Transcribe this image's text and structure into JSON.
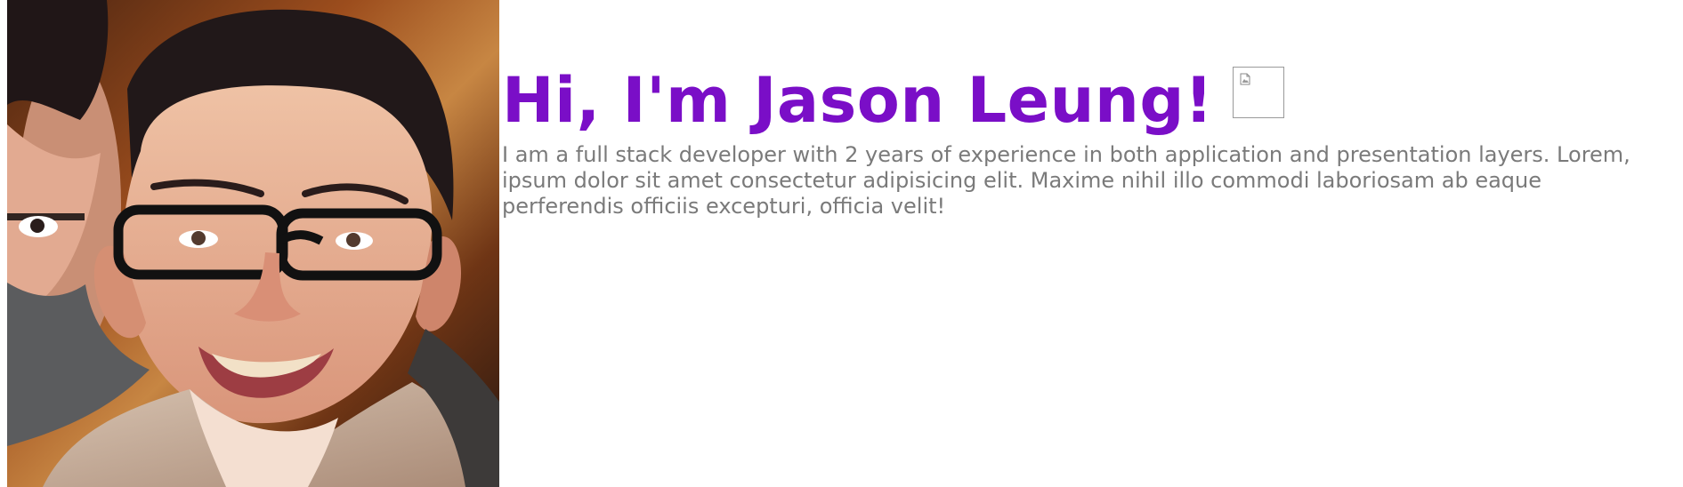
{
  "hero": {
    "headline": "Hi, I'm Jason Leung!",
    "bio": "I am a full stack developer with 2 years of experience in both application and presentation layers. Lorem, ipsum dolor sit amet consectetur adipisicing elit. Maxime nihil illo commodi laboriosam ab eaque perferendis officiis excepturi, officia velit!",
    "colors": {
      "headline": "#7a0ec7",
      "bio": "#7a7a7a",
      "background": "#ffffff"
    }
  },
  "images": {
    "profile_photo": "profile-photo",
    "inline_image": "broken-image-icon"
  }
}
